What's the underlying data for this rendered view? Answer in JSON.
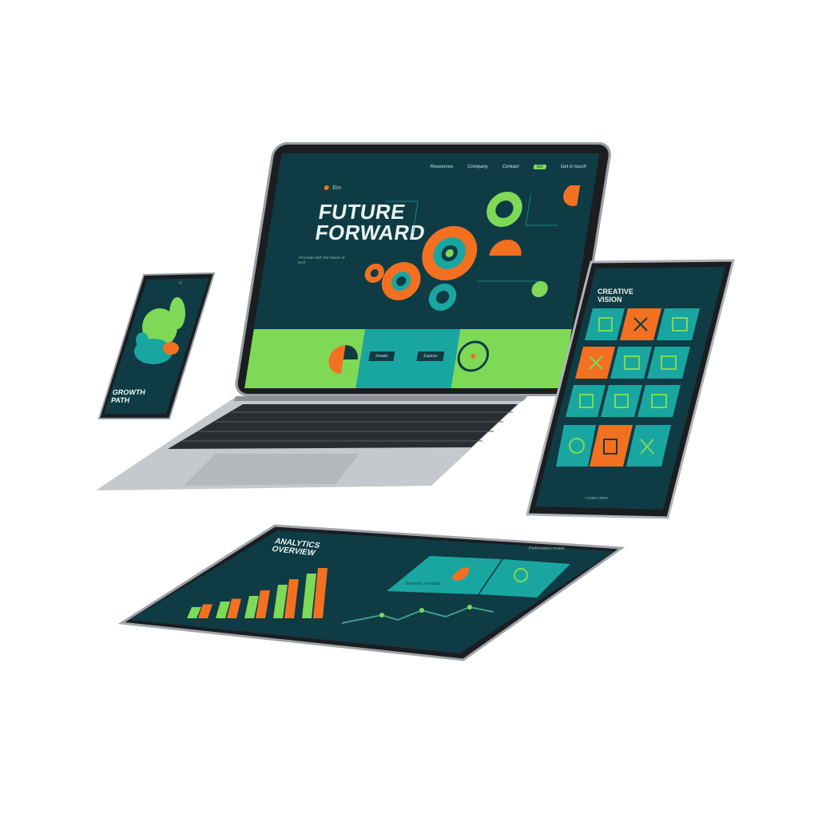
{
  "laptop": {
    "brand": "Eco",
    "nav": [
      "Resources",
      "Company",
      "Contact"
    ],
    "nav_pill": "Go",
    "nav_extra": "Get in touch",
    "hero_title_line1": "FUTURE",
    "hero_title_line2": "FORWARD",
    "hero_subtitle": "Innovate with the future of tech",
    "strip_buttons": [
      "Details",
      "Explore"
    ]
  },
  "phone": {
    "title_line1": "GROWTH",
    "title_line2": "PATH"
  },
  "tablet_right": {
    "title_line1": "CREATIVE",
    "title_line2": "VISION",
    "footer": "• Learn more"
  },
  "tablet_bottom": {
    "title_line1": "ANALYTICS",
    "title_line2": "OVERVIEW",
    "header_link": "Performance review",
    "card_caption": "Summary of results"
  },
  "bar_chart": {
    "type": "bar",
    "series": [
      {
        "values": [
          2,
          3,
          4,
          6,
          8
        ]
      },
      {
        "values": [
          2.5,
          3.5,
          5,
          7,
          9
        ]
      }
    ]
  },
  "colors": {
    "teal_dark": "#0f3b45",
    "teal": "#1aa6a0",
    "green": "#7ed957",
    "orange": "#f37021"
  }
}
